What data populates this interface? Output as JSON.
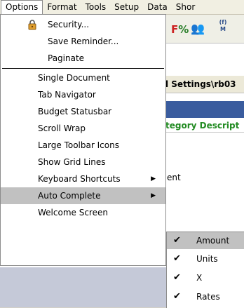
{
  "menubar": [
    "Options",
    "Format",
    "Tools",
    "Setup",
    "Data",
    "Shor"
  ],
  "toolbar": {
    "fx_f": "F",
    "fx_pct": "%",
    "people_icon": "👥",
    "fm_label": "(f)\nM"
  },
  "background": {
    "path_text": "l Settings\\rb03",
    "category_text": "tegory Descript",
    "stray_text": "ent"
  },
  "options_menu": {
    "security": "Security...",
    "save_reminder": "Save Reminder...",
    "paginate": "Paginate",
    "single_document": "Single Document",
    "tab_navigator": "Tab Navigator",
    "budget_statusbar": "Budget Statusbar",
    "scroll_wrap": "Scroll Wrap",
    "large_toolbar_icons": "Large Toolbar Icons",
    "show_grid_lines": "Show Grid Lines",
    "keyboard_shortcuts": "Keyboard Shortcuts",
    "auto_complete": "Auto Complete",
    "welcome_screen": "Welcome Screen"
  },
  "auto_complete_submenu": {
    "items": [
      "Amount",
      "Units",
      "X",
      "Rates"
    ],
    "check": "✔"
  },
  "glyphs": {
    "submenu_arrow": "▶"
  }
}
